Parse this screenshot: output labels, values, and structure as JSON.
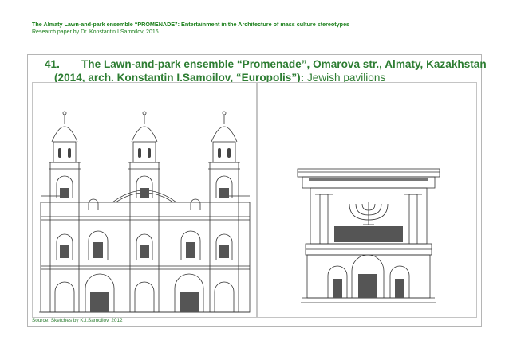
{
  "header": {
    "line1": "The Almaty Lawn-and-park ensemble “PROMENADE”: Entertainment in the Architecture of mass culture stereotypes",
    "line2": "Research paper by Dr. Konstantin I.Samoilov, 2016"
  },
  "slide": {
    "number": "41.",
    "title_line1": "The Lawn-and-park ensemble “Promenade”, Omarova str., Almaty, Kazakhstan",
    "title_line2_bold": "(2014, arch. Konstantin I.Samoilov, “Europolis”):",
    "title_line2_normal": " Jewish pavilions"
  },
  "figures": {
    "left": "sketch-facade-three-towers",
    "right": "sketch-pavilion-menorah"
  },
  "source": "Source: Sketches by K.I.Samoilov, 2012",
  "colors": {
    "accent_green": "#2d7d32",
    "header_green": "#1a7f1a"
  }
}
